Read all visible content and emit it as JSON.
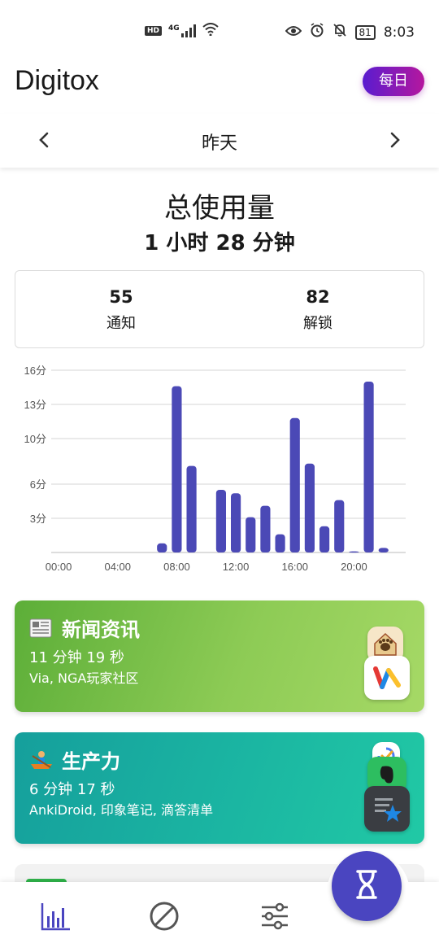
{
  "status_bar": {
    "network": "4G",
    "hd": "HD",
    "battery": "81",
    "time": "8:03"
  },
  "header": {
    "app_title": "Digitox",
    "period_button": "每日"
  },
  "day_nav": {
    "label": "昨天",
    "prev_icon": "chevron-left-icon",
    "next_icon": "chevron-right-icon"
  },
  "summary": {
    "title": "总使用量",
    "value": "1 小时 28 分钟",
    "notifications_value": "55",
    "notifications_label": "通知",
    "unlocks_value": "82",
    "unlocks_label": "解锁"
  },
  "chart_data": {
    "type": "bar",
    "y_unit": "minutes",
    "y_ticks": [
      3,
      6,
      10,
      13,
      16
    ],
    "y_tick_labels": [
      "3分",
      "6分",
      "10分",
      "13分",
      "16分"
    ],
    "ylim": [
      0,
      16
    ],
    "x_tick_labels": [
      "00:00",
      "04:00",
      "08:00",
      "12:00",
      "16:00",
      "20:00"
    ],
    "x_tick_hours": [
      0,
      4,
      8,
      12,
      16,
      20
    ],
    "hours": [
      0,
      1,
      2,
      3,
      4,
      5,
      6,
      7,
      8,
      9,
      10,
      11,
      12,
      13,
      14,
      15,
      16,
      17,
      18,
      19,
      20,
      21,
      22,
      23
    ],
    "values": [
      0,
      0,
      0,
      0,
      0,
      0,
      0,
      0.8,
      14.6,
      7.6,
      0,
      5.5,
      5.2,
      3.1,
      4.1,
      1.6,
      11.8,
      7.8,
      2.3,
      4.6,
      0.1,
      15,
      0.4,
      0
    ],
    "bar_color": "#4b49b6",
    "grid": true
  },
  "categories": [
    {
      "emoji": "newspaper-icon",
      "title": "新闻资讯",
      "time": "11 分钟 19 秒",
      "apps": "Via, NGA玩家社区",
      "app_icons": [
        "nga-icon",
        "via-browser-icon"
      ]
    },
    {
      "emoji": "rowing-boat-icon",
      "title": "生产力",
      "time": "6 分钟 17 秒",
      "apps": "AnkiDroid, 印象笔记, 滴答清单",
      "app_icons": [
        "ticktick-icon",
        "evernote-icon",
        "ankidroid-icon"
      ]
    }
  ],
  "bottom_nav": {
    "items": [
      "bar-chart-icon",
      "block-icon",
      "sliders-icon"
    ],
    "fab": "hourglass-icon",
    "accent": "#4a45c0"
  }
}
